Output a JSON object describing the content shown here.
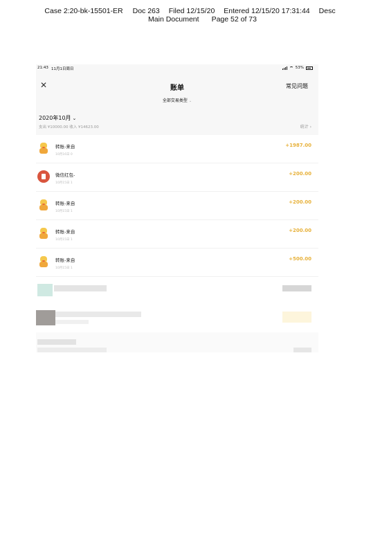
{
  "court_header": {
    "case": "Case 2:20-bk-15501-ER",
    "doc": "Doc 263",
    "filed": "Filed 12/15/20",
    "entered": "Entered 12/15/20 17:31:44",
    "desc": "Desc",
    "main_document": "Main Document",
    "page": "Page 52 of 73"
  },
  "statusbar": {
    "time": "21:43",
    "date": "11月1日周日",
    "battery": "53%"
  },
  "nav": {
    "close_icon": "close-icon",
    "title": "账单",
    "faq": "常见问题",
    "filter": "全部交易类型",
    "filter_caret": "⌄"
  },
  "month": {
    "label": "2020年10月",
    "chevron": "⌄",
    "summary": "支出 ¥10000.00 收入 ¥14623.00",
    "stats": "统计 ›"
  },
  "transactions": [
    {
      "icon": "duck-avatar-icon",
      "title": "转账-来自",
      "date": "10月16日 0",
      "amount": "+1987.00"
    },
    {
      "icon": "red-packet-icon",
      "title": "微信红包-",
      "date": "10月15日 1",
      "amount": "+200.00"
    },
    {
      "icon": "duck-avatar-icon",
      "title": "转账-来自",
      "date": "10月15日 1",
      "amount": "+200.00"
    },
    {
      "icon": "duck-avatar-icon",
      "title": "转账-来自",
      "date": "10月15日 1",
      "amount": "+200.00"
    },
    {
      "icon": "duck-avatar-icon",
      "title": "转账-来自",
      "date": "10月15日 1",
      "amount": "+500.00"
    }
  ],
  "colors": {
    "amount": "#e7b13a",
    "header_bg": "#f7f7f7",
    "red_packet": "#d9553e"
  }
}
